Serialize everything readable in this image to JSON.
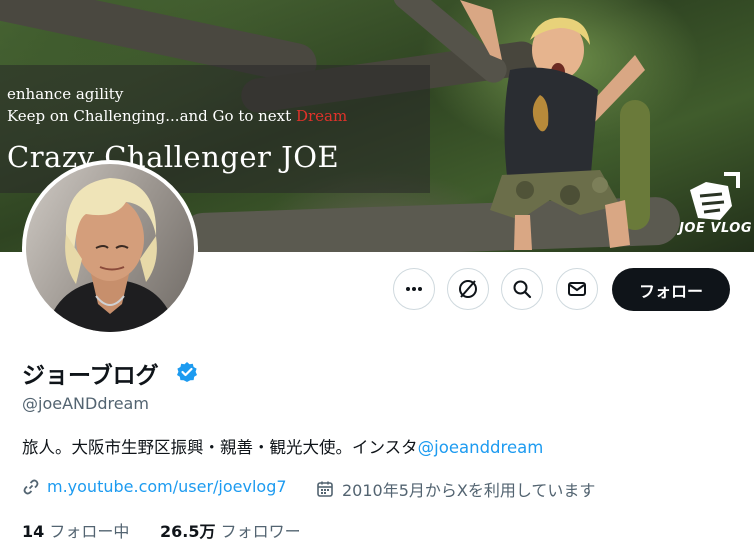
{
  "banner": {
    "line1": "enhance agility",
    "line2_prefix": "Keep on Challenging...and Go to next ",
    "line2_red": "Dream",
    "title": "Crazy Challenger JOE",
    "logo_text": "JOE VLOG"
  },
  "actions": {
    "more_icon": "more-icon",
    "grok_icon": "grok-icon",
    "search_icon": "search-icon",
    "message_icon": "message-icon",
    "follow_label": "フォロー"
  },
  "profile": {
    "name": "ジョーブログ",
    "handle": "@joeANDdream",
    "bio_text": "旅人。大阪市生野区振興・親善・観光大使。インスタ",
    "bio_link": "@joeanddream",
    "website": "m.youtube.com/user/joevlog7",
    "joined": "2010年5月からXを利用しています",
    "following_count": "14",
    "following_label": "フォロー中",
    "followers_count": "26.5万",
    "followers_label": "フォロワー"
  },
  "colors": {
    "accent": "#1d9bf0",
    "text": "#0f1419",
    "muted": "#536471",
    "dream_red": "#e0322a"
  }
}
